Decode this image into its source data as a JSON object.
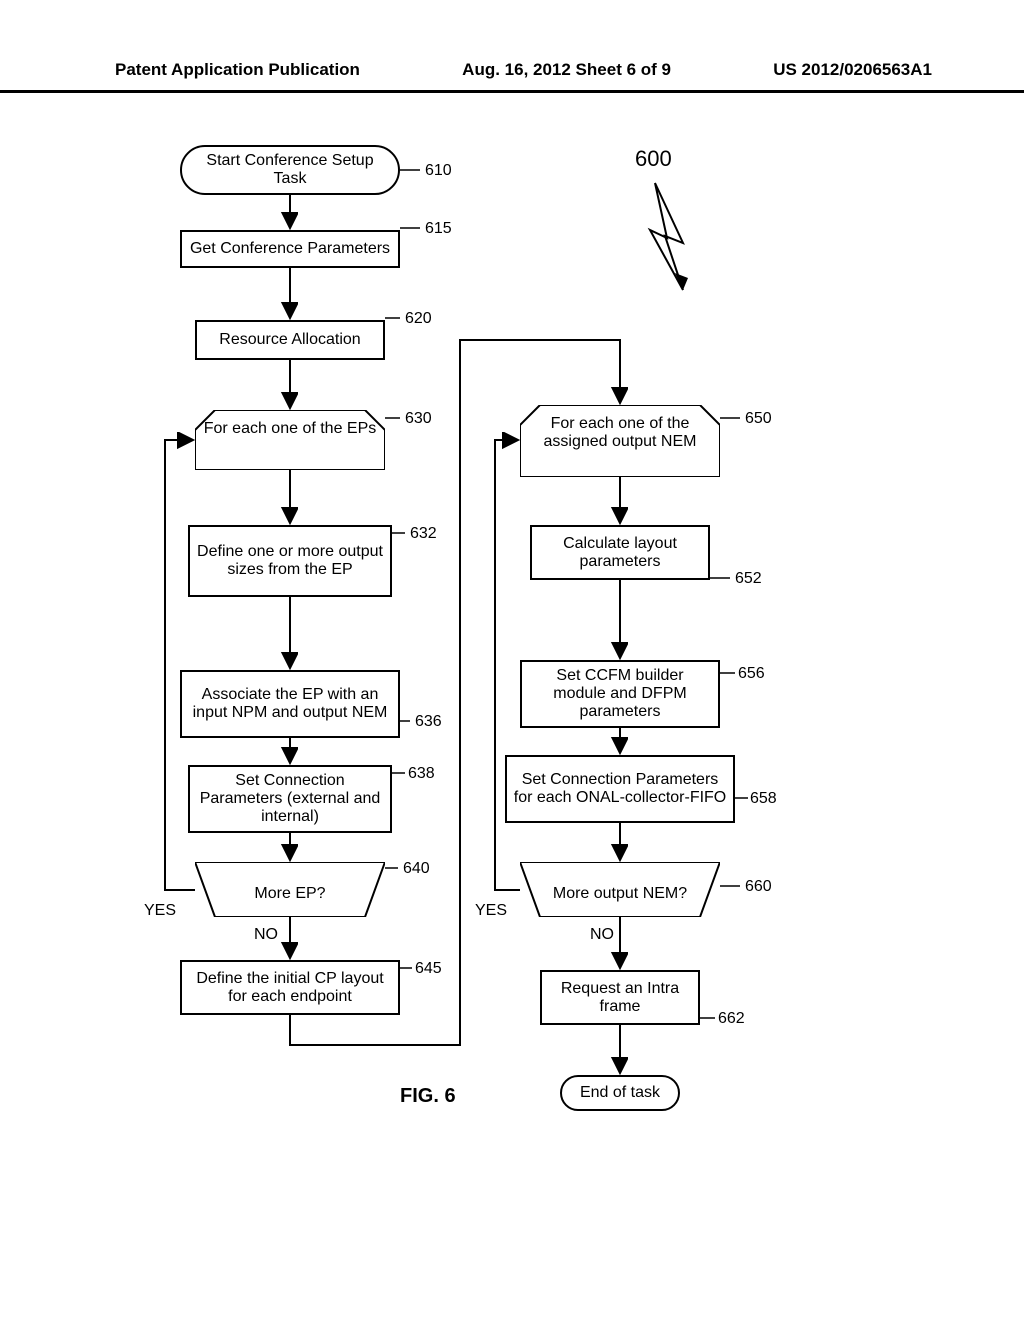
{
  "header": {
    "left": "Patent Application Publication",
    "center": "Aug. 16, 2012  Sheet 6 of 9",
    "right": "US 2012/0206563A1"
  },
  "figure_number": "600",
  "figure_label": "FIG. 6",
  "nodes": {
    "n610": "Start Conference Setup Task",
    "n615": "Get Conference Parameters",
    "n620": "Resource Allocation",
    "n630": "For each one of the EPs",
    "n632": "Define one or more output sizes from the EP",
    "n636": "Associate the EP with an input NPM and output NEM",
    "n638": "Set Connection Parameters (external and internal)",
    "n640": "More EP?",
    "n645": "Define the initial CP layout for each endpoint",
    "n650": "For each one of the assigned output NEM",
    "n652": "Calculate layout parameters",
    "n656": "Set CCFM builder module and DFPM parameters",
    "n658": "Set Connection Parameters for each ONAL-collector-FIFO",
    "n660": "More output NEM?",
    "n662": "Request an Intra frame",
    "nend": "End of task"
  },
  "refs": {
    "r610": "610",
    "r615": "615",
    "r620": "620",
    "r630": "630",
    "r632": "632",
    "r636": "636",
    "r638": "638",
    "r640": "640",
    "r645": "645",
    "r650": "650",
    "r652": "652",
    "r656": "656",
    "r658": "658",
    "r660": "660",
    "r662": "662"
  },
  "branches": {
    "yes": "YES",
    "no": "NO"
  }
}
